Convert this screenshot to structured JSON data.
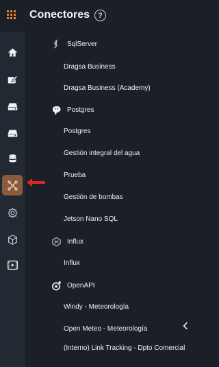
{
  "header": {
    "title": "Conectores",
    "help_label": "?"
  },
  "sidebar": {
    "items": [
      {
        "name": "home-icon",
        "active": false
      },
      {
        "name": "edit-board-icon",
        "active": false
      },
      {
        "name": "drive-icon",
        "active": false
      },
      {
        "name": "drive-alt-icon",
        "active": false
      },
      {
        "name": "database-icon",
        "active": false
      },
      {
        "name": "connectors-icon",
        "active": true
      },
      {
        "name": "model-icon",
        "active": false
      },
      {
        "name": "cube-icon",
        "active": false
      },
      {
        "name": "media-icon",
        "active": false
      }
    ],
    "active_color": "#8a5a3c"
  },
  "connectors": [
    {
      "type": "SqlServer",
      "icon": "sqlserver-icon",
      "items": [
        "Dragsa Business",
        "Dragsa Business (Academy)"
      ]
    },
    {
      "type": "Postgres",
      "icon": "postgres-icon",
      "items": [
        "Postgres",
        "Gestión integral del agua",
        "Prueba",
        "Gestión de bombas",
        "Jetson Nano SQL"
      ]
    },
    {
      "type": "Influx",
      "icon": "influx-icon",
      "items": [
        "Influx"
      ]
    },
    {
      "type": "OpenAPI",
      "icon": "openapi-icon",
      "items": [
        "Windy - Meteorología",
        "Open Meteo - Meteorología",
        "(Interno) Link Tracking - Dpto Comercial"
      ]
    }
  ],
  "colors": {
    "background": "#1b2028",
    "sidebar": "#222933",
    "accent": "#e88a2a",
    "arrow": "#e0261f"
  }
}
